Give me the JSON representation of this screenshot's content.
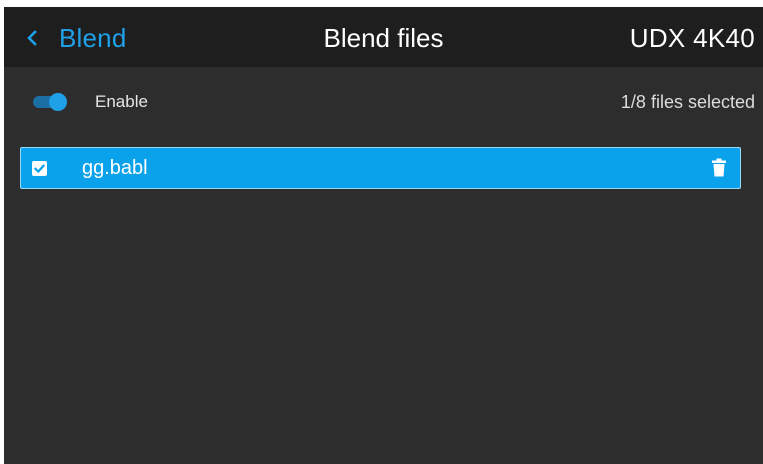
{
  "header": {
    "back_label": "Blend",
    "title": "Blend files",
    "device_name": "UDX 4K40"
  },
  "controls": {
    "enable_label": "Enable",
    "enable_on": true,
    "files_selected_text": "1/8 files selected"
  },
  "files": [
    {
      "name": "gg.babl",
      "selected": true,
      "icons": [
        "checkbox-checked-icon",
        "trash-icon"
      ]
    }
  ],
  "colors": {
    "accent": "#1fa1e8",
    "selected_row": "#0aa2ea",
    "background": "#2d2d2d",
    "header_background": "#1e1e1e"
  }
}
